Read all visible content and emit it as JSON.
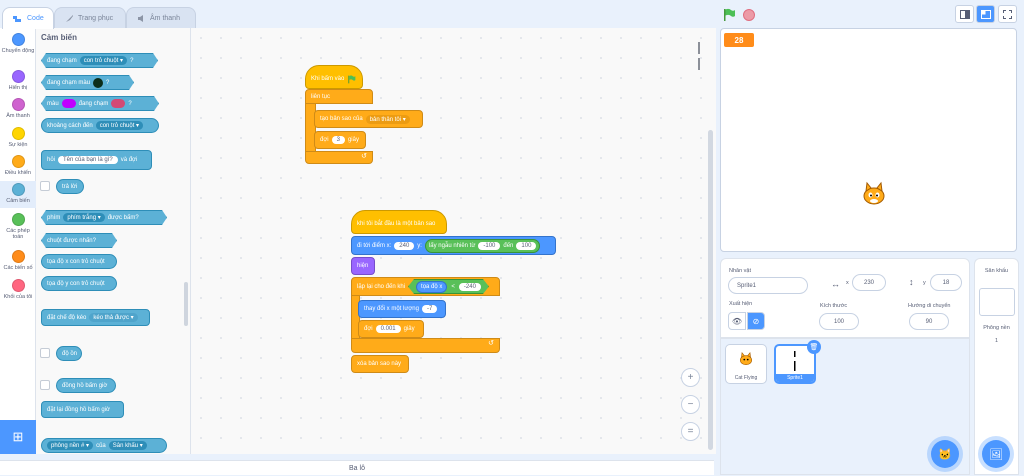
{
  "tabs": [
    {
      "label": "Code",
      "icon": "code-icon"
    },
    {
      "label": "Trang phục",
      "icon": "brush-icon"
    },
    {
      "label": "Âm thanh",
      "icon": "speaker-icon"
    }
  ],
  "categories": [
    {
      "label": "Chuyển động",
      "color": "#4c97ff"
    },
    {
      "label": "Hiển thị",
      "color": "#9966ff"
    },
    {
      "label": "Âm thanh",
      "color": "#cf63cf"
    },
    {
      "label": "Sự kiện",
      "color": "#ffd500"
    },
    {
      "label": "Điều khiển",
      "color": "#ffab19"
    },
    {
      "label": "Cảm biến",
      "color": "#5cb1d6"
    },
    {
      "label": "Các phép toán",
      "color": "#59c059"
    },
    {
      "label": "Các biến số",
      "color": "#ff8c1a"
    },
    {
      "label": "Khối của tôi",
      "color": "#ff6680"
    }
  ],
  "palette": {
    "title": "Cảm biến",
    "touching": {
      "text": "đang chạm",
      "menu": "con trỏ chuột",
      "q": "?"
    },
    "touching_color": {
      "text": "đang chạm màu",
      "q": "?"
    },
    "color_touching": {
      "a": "màu",
      "b": "đang chạm",
      "q": "?"
    },
    "distance": {
      "text": "khoảng cách đến",
      "menu": "con trỏ chuột"
    },
    "ask": {
      "a": "hỏi",
      "input": "Tên của bạn là gì?",
      "b": "và đợi"
    },
    "answer": "trả lời",
    "keypress": {
      "a": "phím",
      "menu": "phím trắng",
      "b": "được bấm?"
    },
    "mousedown": "chuột được nhấn?",
    "mousex": "tọa độ x con trỏ chuột",
    "mousey": "tọa độ y con trỏ chuột",
    "drag": {
      "text": "đặt chế độ kéo",
      "menu": "kéo thả được"
    },
    "loudness": "độ ồn",
    "timer": "đồng hồ bấm giờ",
    "reset_timer": "đặt lại đồng hồ bấm giờ",
    "backdrop": {
      "menu": "phông nền #",
      "of": "của",
      "target": "Sân khấu"
    }
  },
  "workspace": {
    "script1": {
      "hat": "Khi bấm vào",
      "forever": "liên tục",
      "clone": {
        "text": "tạo bản sao của",
        "menu": "bản thân tôi"
      },
      "wait": {
        "a": "đợi",
        "value": "3",
        "b": "giây"
      }
    },
    "script2": {
      "hat": "khi tôi bắt đầu là một bản sao",
      "goto": {
        "a": "đi tới điểm x:",
        "x": "240",
        "b": "y:",
        "rand": "lấy ngẫu nhiên từ",
        "from": "-100",
        "to_word": "đến",
        "to": "100"
      },
      "show": "hiện",
      "repeat": {
        "a": "lặp lại cho đến khi",
        "xpos": "tọa độ x",
        "op": "<",
        "val": "-240"
      },
      "change": {
        "text": "thay đổi x một lượng",
        "value": "-7"
      },
      "wait": {
        "a": "đợi",
        "value": "0.001",
        "b": "giây"
      },
      "delete": "xóa bản sao này"
    },
    "zoom": [
      "+",
      "−",
      "="
    ]
  },
  "backpack": "Ba lô",
  "stage": {
    "counter": "28"
  },
  "sprite_info": {
    "sprite_label": "Nhân vật",
    "sprite_name": "Sprite1",
    "x_label": "x",
    "x": "230",
    "y_label": "y",
    "y": "18",
    "show_label": "Xuất hiện",
    "size_label": "Kích thước",
    "size": "100",
    "dir_label": "Hướng di chuyển",
    "dir": "90"
  },
  "sprites": [
    {
      "name": "Cat Flying"
    },
    {
      "name": "Sprite1"
    }
  ],
  "stage_panel": {
    "title": "Sân khấu",
    "backdrops_label": "Phông nền",
    "backdrops_count": "1"
  }
}
